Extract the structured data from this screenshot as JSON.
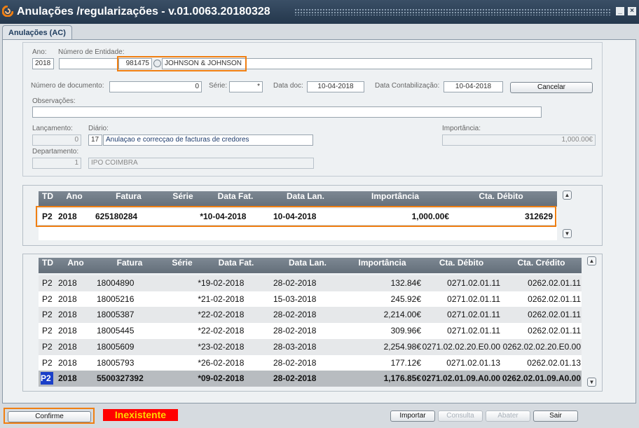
{
  "window": {
    "title": "Anulações /regularizações - v.01.0063.20180328",
    "minimize": "_",
    "close": "×"
  },
  "tab": {
    "label": "Anulações (AC)"
  },
  "form": {
    "ano_label": "Ano:",
    "ano": "2018",
    "entidade_label": "Número de Entidade:",
    "entidade_num": "981475",
    "entidade_nome": "JOHNSON & JOHNSON",
    "doc_label": "Número de documento:",
    "doc": "0",
    "serie_label": "Série:",
    "serie": "*",
    "data_doc_label": "Data doc:",
    "data_doc": "10-04-2018",
    "data_cont_label": "Data Contabilização:",
    "data_cont": "10-04-2018",
    "cancelar": "Cancelar",
    "obs_label": "Observações:",
    "obs": "",
    "lanc_label": "Lançamento:",
    "lanc": "0",
    "diario_label": "Diário:",
    "diario_num": "17",
    "diario_desc": "Anulaçao e correcçao de facturas de credores",
    "importancia_label": "Importância:",
    "importancia": "1,000.00€",
    "dep_label": "Departamento:",
    "dep_num": "1",
    "dep_desc": "IPO COIMBRA"
  },
  "top_grid": {
    "headers": [
      "TD",
      "Ano",
      "Fatura",
      "Série",
      "Data Fat.",
      "Data Lan.",
      "Importância",
      "Cta. Débito"
    ],
    "rows": [
      [
        "P2",
        "2018",
        "625180284",
        "*",
        "10-04-2018",
        "10-04-2018",
        "1,000.00€",
        "312629"
      ]
    ]
  },
  "bottom_grid": {
    "headers": [
      "TD",
      "Ano",
      "Fatura",
      "Série",
      "Data Fat.",
      "Data Lan.",
      "Importância",
      "Cta. Débito",
      "Cta. Crédito"
    ],
    "rows": [
      [
        "P2",
        "2018",
        "18004890",
        "*",
        "19-02-2018",
        "28-02-2018",
        "132.84€",
        "0271.02.01.11",
        "0262.02.01.11"
      ],
      [
        "P2",
        "2018",
        "18005216",
        "*",
        "21-02-2018",
        "15-03-2018",
        "245.92€",
        "0271.02.01.11",
        "0262.02.01.11"
      ],
      [
        "P2",
        "2018",
        "18005387",
        "*",
        "22-02-2018",
        "28-02-2018",
        "2,214.00€",
        "0271.02.01.11",
        "0262.02.01.11"
      ],
      [
        "P2",
        "2018",
        "18005445",
        "*",
        "22-02-2018",
        "28-02-2018",
        "309.96€",
        "0271.02.01.11",
        "0262.02.01.11"
      ],
      [
        "P2",
        "2018",
        "18005609",
        "*",
        "23-02-2018",
        "28-03-2018",
        "2,254.98€",
        "0271.02.02.20.E0.00",
        "0262.02.02.20.E0.00"
      ],
      [
        "P2",
        "2018",
        "18005793",
        "*",
        "26-02-2018",
        "28-02-2018",
        "177.12€",
        "0271.02.01.13",
        "0262.02.01.13"
      ],
      [
        "P2",
        "2018",
        "5500327392",
        "*",
        "09-02-2018",
        "28-02-2018",
        "1,176.85€",
        "0271.02.01.09.A0.00",
        "0262.02.01.09.A0.00"
      ]
    ]
  },
  "footer": {
    "confirme": "Confirme",
    "status": "Inexistente",
    "importar": "Importar",
    "consulta": "Consulta",
    "abater": "Abater",
    "sair": "Sair"
  },
  "colors": {
    "titlebar": "#2d4257",
    "accent": "#f07f12",
    "status_bg": "#ff0000",
    "status_text": "#ffd500"
  }
}
